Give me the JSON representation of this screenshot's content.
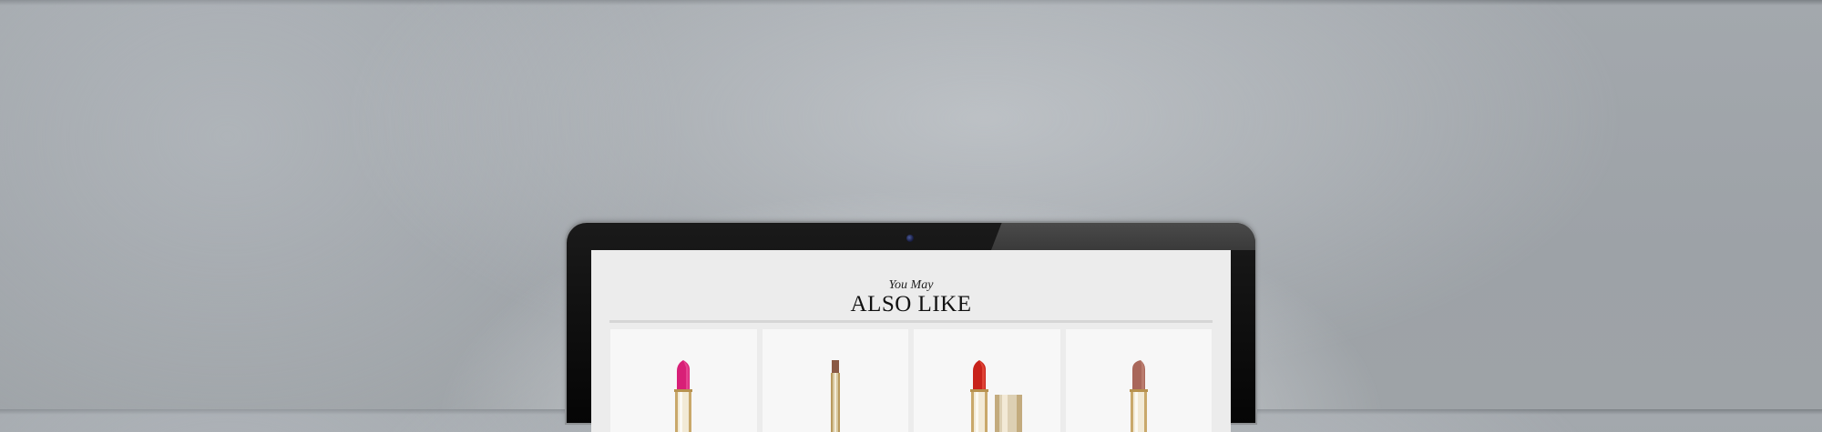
{
  "page": {
    "subtitle": "You May",
    "title": "ALSO LIKE"
  },
  "products": [
    {
      "name": "lipstick-pink-icon",
      "color": "#d81f77"
    },
    {
      "name": "lip-liner-icon",
      "color": "#8a5a45"
    },
    {
      "name": "lipstick-red-icon",
      "color": "#c8221a"
    },
    {
      "name": "lipstick-nude-icon",
      "color": "#a9675a"
    }
  ],
  "colors": {
    "laptop_bezel": "#0a0a0a",
    "screen_bg": "#ececec",
    "gold": "#c9a86a"
  }
}
